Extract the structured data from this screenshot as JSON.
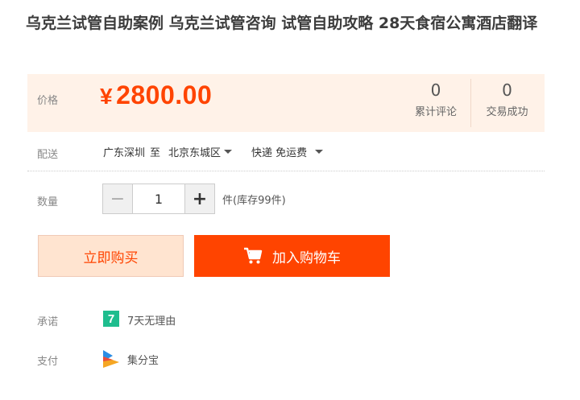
{
  "product": {
    "title": "乌克兰试管自助案例 乌克兰试管咨询 试管自助攻略 28天食宿公寓酒店翻译"
  },
  "price": {
    "label": "价格",
    "currency": "¥",
    "value": "2800.00",
    "reviews_count": "0",
    "reviews_label": "累计评论",
    "sales_count": "0",
    "sales_label": "交易成功"
  },
  "delivery": {
    "label": "配送",
    "from": "广东深圳",
    "to_word": "至",
    "destination": "北京东城区",
    "shipping": "快递 免运费"
  },
  "quantity": {
    "label": "数量",
    "minus": "−",
    "value": "1",
    "plus": "+",
    "stock": "件(库存99件)"
  },
  "actions": {
    "buy_now": "立即购买",
    "add_to_cart": "加入购物车"
  },
  "promise": {
    "label": "承诺",
    "icon_text": "7",
    "text": "7天无理由"
  },
  "payment": {
    "label": "支付",
    "text": "集分宝"
  },
  "colors": {
    "accent": "#ff4400",
    "price_bg": "#fff2e8",
    "promise_icon": "#1ebd8e"
  }
}
